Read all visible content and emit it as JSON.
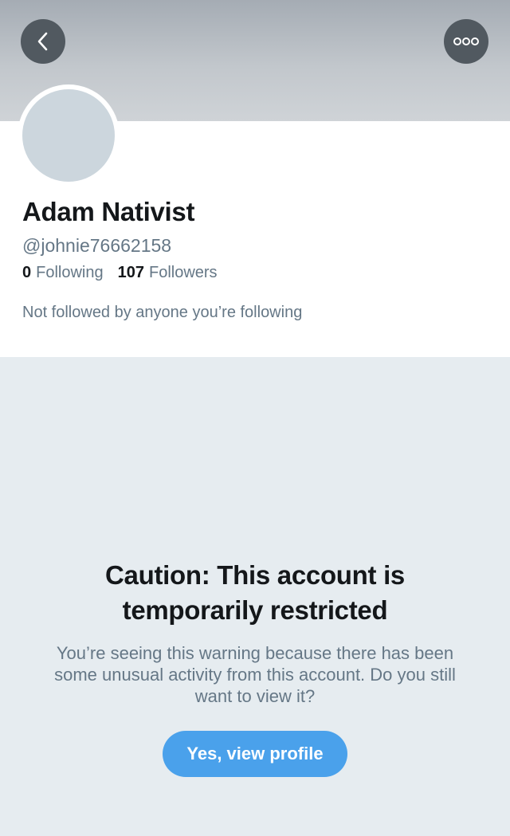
{
  "header": {
    "back_icon": "chevron-left-icon",
    "more_icon": "more-options-icon"
  },
  "profile": {
    "display_name": "Adam Nativist",
    "handle": "@johnie76662158",
    "following_count": "0",
    "following_label": "Following",
    "followers_count": "107",
    "followers_label": "Followers",
    "context": "Not followed by anyone you’re following"
  },
  "warning": {
    "title": "Caution: This account is temporarily restricted",
    "body": "You’re seeing this warning because there has been some unusual activity from this account. Do you still want to view it?",
    "button_label": "Yes, view profile"
  },
  "colors": {
    "accent": "#4aa1eb",
    "page_background": "#e6ecf0",
    "secondary_text": "#657786",
    "avatar_placeholder": "#ccd6dd"
  }
}
